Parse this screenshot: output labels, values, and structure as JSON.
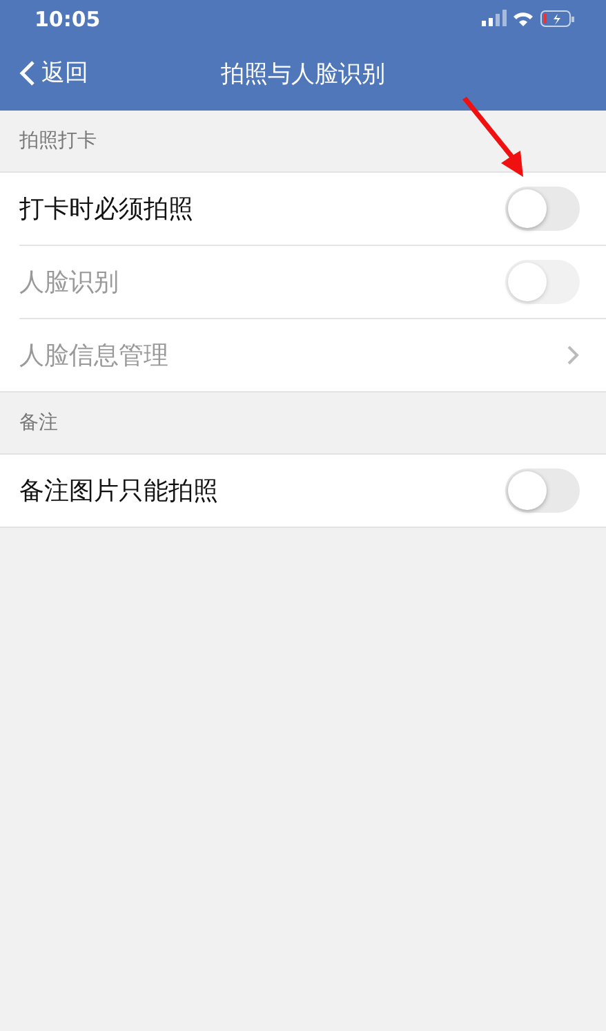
{
  "status_bar": {
    "time": "10:05"
  },
  "nav": {
    "back": "返回",
    "title": "拍照与人脸识别"
  },
  "sections": [
    {
      "header": "拍照打卡",
      "rows": [
        {
          "kind": "toggle",
          "label": "打卡时必须拍照",
          "on": false,
          "disabled": false
        },
        {
          "kind": "toggle",
          "label": "人脸识别",
          "on": false,
          "disabled": true
        },
        {
          "kind": "link",
          "label": "人脸信息管理",
          "disabled": true
        }
      ]
    },
    {
      "header": "备注",
      "rows": [
        {
          "kind": "toggle",
          "label": "备注图片只能拍照",
          "on": false,
          "disabled": false
        }
      ]
    }
  ]
}
